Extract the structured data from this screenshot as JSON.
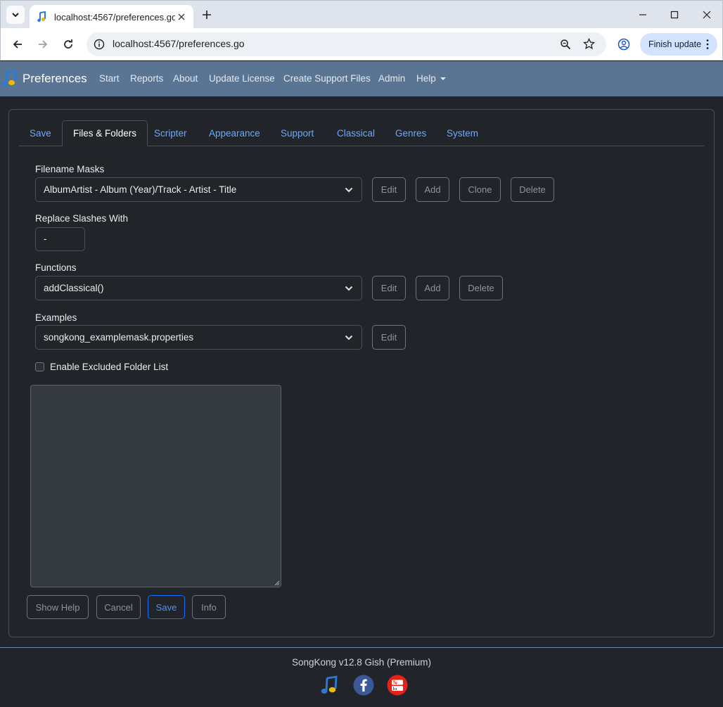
{
  "browser": {
    "tab_title": "localhost:4567/preferences.go",
    "url": "localhost:4567/preferences.go",
    "finish_update_label": "Finish update"
  },
  "navbar": {
    "brand": "Preferences",
    "links": [
      "Start",
      "Reports",
      "About",
      "Update License",
      "Create Support Files",
      "Admin",
      "Help"
    ]
  },
  "tabs": [
    "Save",
    "Files & Folders",
    "Scripter",
    "Appearance",
    "Support",
    "Classical",
    "Genres",
    "System"
  ],
  "active_tab": "Files & Folders",
  "form": {
    "filename_masks": {
      "label": "Filename Masks",
      "value": "AlbumArtist - Album (Year)/Track - Artist - Title",
      "buttons": [
        "Edit",
        "Add",
        "Clone",
        "Delete"
      ]
    },
    "replace_slashes": {
      "label": "Replace Slashes With",
      "value": "-"
    },
    "functions": {
      "label": "Functions",
      "value": "addClassical()",
      "buttons": [
        "Edit",
        "Add",
        "Delete"
      ]
    },
    "examples": {
      "label": "Examples",
      "value": "songkong_examplemask.properties",
      "buttons": [
        "Edit"
      ]
    },
    "excluded_folders": {
      "label": "Enable Excluded Folder List",
      "checked": false
    }
  },
  "actions": [
    "Show Help",
    "Cancel",
    "Save",
    "Info"
  ],
  "footer": {
    "version": "SongKong v12.8 Gish (Premium)"
  },
  "colors": {
    "navbar_bg": "#5a7593",
    "page_bg": "#212529",
    "link_blue": "#6ea8fe",
    "primary": "#0d6efd"
  }
}
